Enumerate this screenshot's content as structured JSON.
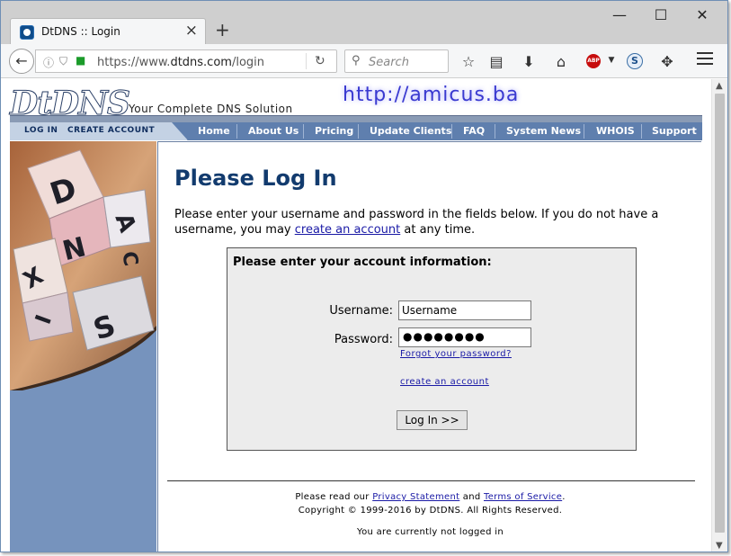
{
  "browser": {
    "tab_title": "DtDNS :: Login",
    "new_tab": "+",
    "url_prefix": "https://www.",
    "url_domain": "dtdns.com",
    "url_path": "/login",
    "search_placeholder": "Search",
    "win_minimize": "—",
    "win_maximize": "☐",
    "win_close": "✕",
    "tab_close": "×",
    "toolbar_icons": [
      "star-icon",
      "reader-icon",
      "download-icon",
      "home-icon",
      "adblock-icon",
      "s-icon",
      "extension-icon",
      "menu-icon"
    ]
  },
  "site": {
    "logo": "DtDNS",
    "tagline": "Your Complete DNS Solution",
    "watermark": "http://amicus.ba"
  },
  "account_nav": {
    "login": "LOG IN",
    "create": "CREATE ACCOUNT"
  },
  "nav": [
    "Home",
    "About Us",
    "Pricing",
    "Update Clients",
    "FAQ",
    "System News",
    "WHOIS",
    "Support"
  ],
  "dice_letters": [
    "D",
    "N",
    "A",
    "C",
    "X",
    "I",
    "S"
  ],
  "main": {
    "title": "Please Log In",
    "intro_before": "Please enter your username and password in the fields below. If you do not have a username, you may ",
    "intro_link": "create an account",
    "intro_after": " at any time."
  },
  "login_form": {
    "heading": "Please enter your account information:",
    "username_label": "Username:",
    "username_value": "Username",
    "password_label": "Password:",
    "password_mask": "●●●●●●●●",
    "forgot_link": "Forgot your password?",
    "create_link": "create an account",
    "submit": "Log In >>"
  },
  "footer": {
    "read_prefix": "Please read our ",
    "privacy": "Privacy Statement",
    "and": " and ",
    "terms": "Terms of Service",
    "period": ".",
    "copyright": "Copyright © 1999-2016 by DtDNS. All Rights Reserved.",
    "status": "You are currently not logged in"
  }
}
